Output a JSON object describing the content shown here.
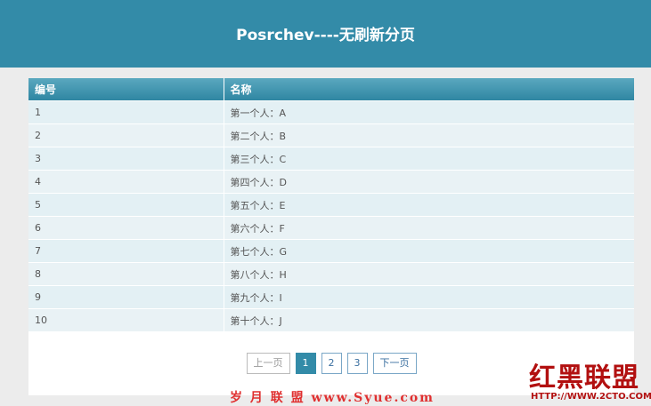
{
  "header": {
    "title": "Posrchev----无刷新分页"
  },
  "table": {
    "columns": [
      "编号",
      "名称"
    ],
    "rows": [
      [
        "1",
        "第一个人：A"
      ],
      [
        "2",
        "第二个人：B"
      ],
      [
        "3",
        "第三个人：C"
      ],
      [
        "4",
        "第四个人：D"
      ],
      [
        "5",
        "第五个人：E"
      ],
      [
        "6",
        "第六个人：F"
      ],
      [
        "7",
        "第七个人：G"
      ],
      [
        "8",
        "第八个人：H"
      ],
      [
        "9",
        "第九个人：I"
      ],
      [
        "10",
        "第十个人：J"
      ]
    ]
  },
  "pager": {
    "prev_label": "上一页",
    "pages": [
      "1",
      "2",
      "3"
    ],
    "current_page": "1",
    "next_label": "下一页"
  },
  "watermarks": {
    "left_text": "岁 月 联 盟  www.Syue.com",
    "right_logo": "红黑联盟",
    "right_url": "HTTP://WWW.2CTO.COM"
  },
  "colors": {
    "header_bg": "#338ba8",
    "row_bg": "#e3f0f4",
    "page_bg": "#ececec",
    "watermark_red": "#b21010"
  }
}
